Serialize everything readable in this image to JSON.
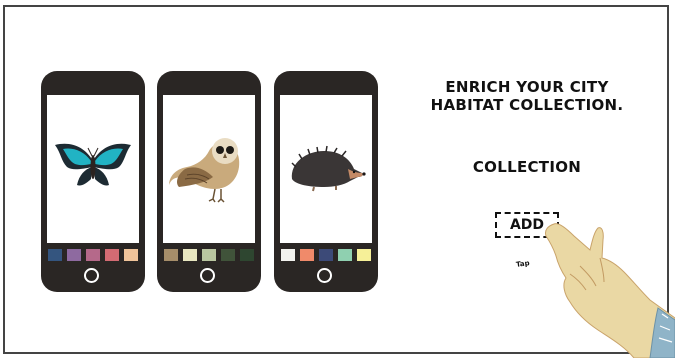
{
  "headline": {
    "line1": "ENRICH YOUR CITY",
    "line2": "HABITAT COLLECTION."
  },
  "collection_label": "COLLECTION",
  "add_button_label": "ADD",
  "tap_label": "Tap",
  "phones": [
    {
      "subject_icon": "butterfly-icon",
      "palette": [
        "#34557f",
        "#8e6aa0",
        "#b5698a",
        "#d36b73",
        "#f0c49a"
      ]
    },
    {
      "subject_icon": "owl-icon",
      "palette": [
        "#a68e6a",
        "#e8e6c0",
        "#b9c6a0",
        "#40533a",
        "#2e4630"
      ]
    },
    {
      "subject_icon": "hedgehog-icon",
      "palette": [
        "#f2f2ee",
        "#f08a6a",
        "#3c4a78",
        "#8fd0b0",
        "#f6f098"
      ]
    }
  ],
  "colors": {
    "phone_body": "#2a2624",
    "frame_border": "#444444",
    "text": "#111111"
  }
}
